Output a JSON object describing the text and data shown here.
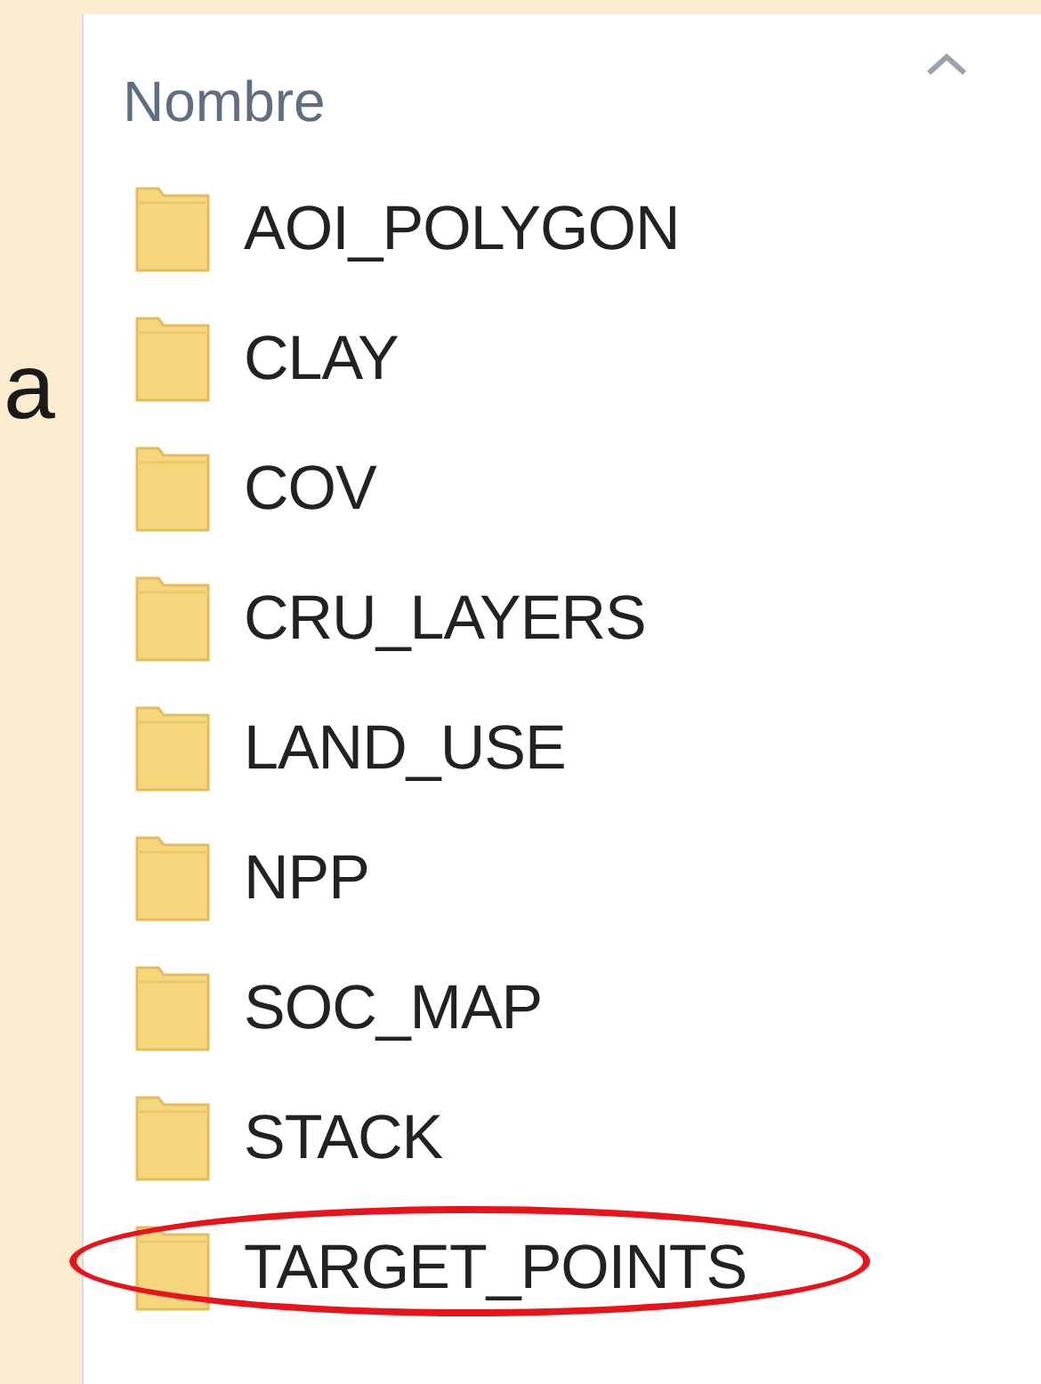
{
  "slide_fragment": {
    "text": "a"
  },
  "file_list": {
    "column_header": "Nombre",
    "items": [
      {
        "name": "AOI_POLYGON",
        "highlighted": false
      },
      {
        "name": "CLAY",
        "highlighted": false
      },
      {
        "name": "COV",
        "highlighted": false
      },
      {
        "name": "CRU_LAYERS",
        "highlighted": false
      },
      {
        "name": "LAND_USE",
        "highlighted": false
      },
      {
        "name": "NPP",
        "highlighted": false
      },
      {
        "name": "SOC_MAP",
        "highlighted": false
      },
      {
        "name": "STACK",
        "highlighted": false
      },
      {
        "name": "TARGET_POINTS",
        "highlighted": true
      }
    ]
  }
}
